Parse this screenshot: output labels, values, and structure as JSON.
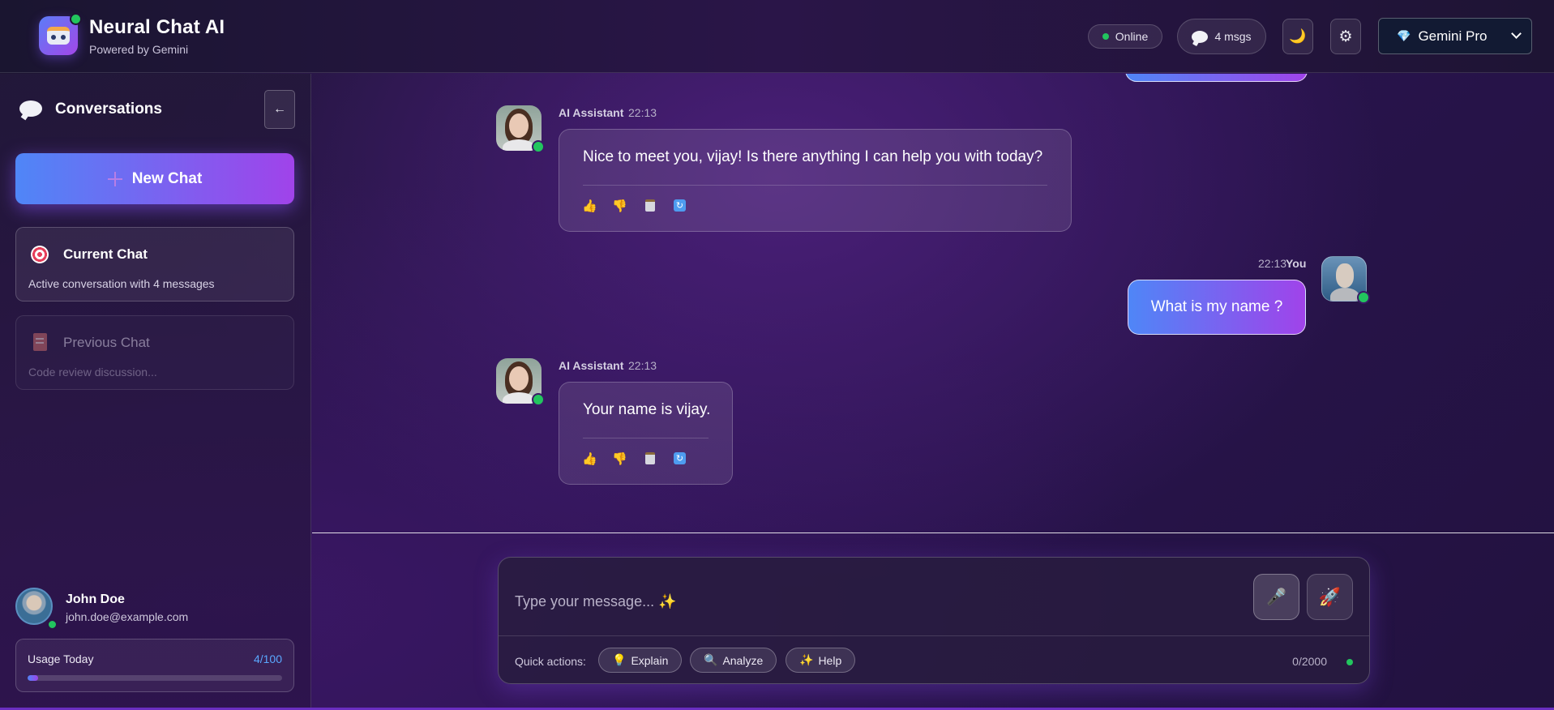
{
  "header": {
    "title": "Neural Chat AI",
    "subtitle": "Powered by Gemini",
    "status": "Online",
    "message_count": "4 msgs",
    "theme_icon": "🌙",
    "settings_icon": "⚙",
    "model": "Gemini Pro",
    "model_icon": "💎"
  },
  "sidebar": {
    "title": "Conversations",
    "collapse_icon": "←",
    "new_chat_label": "New Chat",
    "chats": [
      {
        "title": "Current Chat",
        "subtitle": "Active conversation with 4 messages"
      },
      {
        "title": "Previous Chat",
        "subtitle": "Code review discussion..."
      }
    ],
    "user": {
      "name": "John Doe",
      "email": "john.doe@example.com"
    },
    "usage": {
      "label": "Usage Today",
      "count": "4/100",
      "fraction": 0.04
    }
  },
  "messages": [
    {
      "sender": "AI Assistant",
      "time": "22:13",
      "text": "Nice to meet you, vijay! Is there anything I can help you with today?"
    },
    {
      "sender": "You",
      "time": "22:13",
      "text": "What is my name ?"
    },
    {
      "sender": "AI Assistant",
      "time": "22:13",
      "text": "Your name is vijay."
    }
  ],
  "message_actions": {
    "like": "👍",
    "dislike": "👎",
    "copy": "📋",
    "regenerate": "🔄"
  },
  "composer": {
    "placeholder": "Type your message... ✨",
    "mic_icon": "🎤",
    "send_icon": "🚀",
    "quick_actions_label": "Quick actions:",
    "quick_actions": [
      {
        "icon": "💡",
        "label": "Explain"
      },
      {
        "icon": "🔍",
        "label": "Analyze"
      },
      {
        "icon": "✨",
        "label": "Help"
      }
    ],
    "char_count": "0/2000"
  },
  "colors": {
    "accent_start": "#4f86f7",
    "accent_end": "#a043ea",
    "online": "#22c55e",
    "usage_count": "#5aa8ff"
  }
}
